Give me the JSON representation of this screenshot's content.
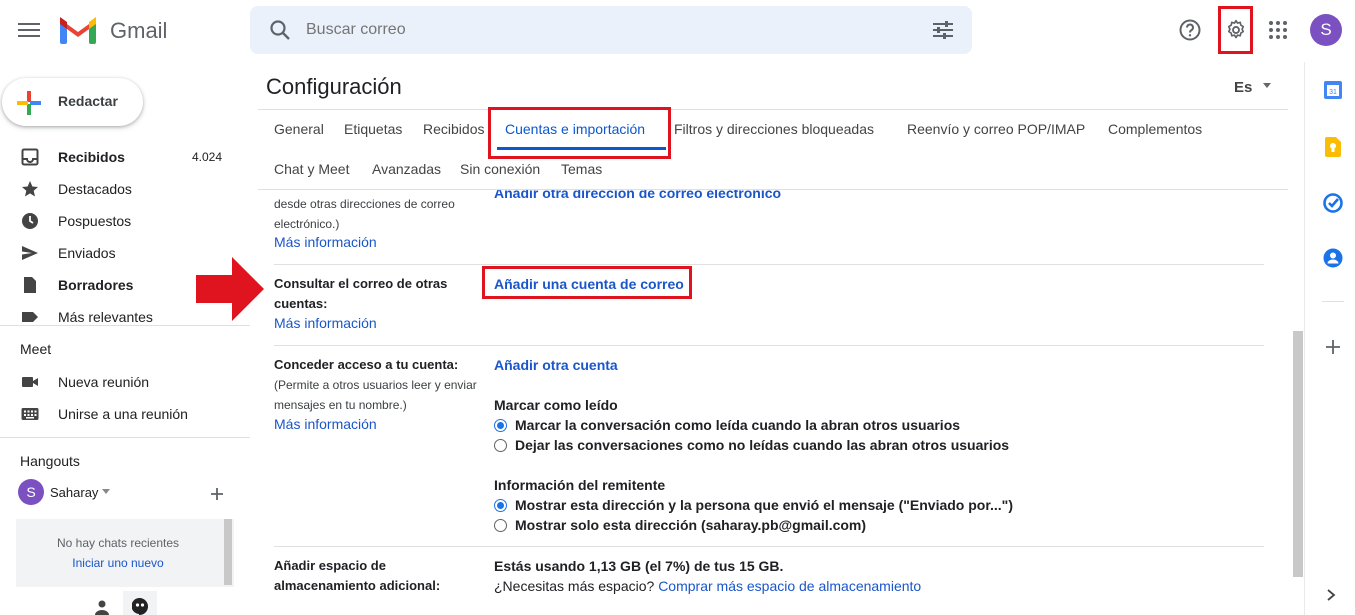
{
  "header": {
    "app_name": "Gmail",
    "search_placeholder": "Buscar correo",
    "avatar_letter": "S"
  },
  "sidebar": {
    "compose_label": "Redactar",
    "items": [
      {
        "label": "Recibidos",
        "count": "4.024"
      },
      {
        "label": "Destacados"
      },
      {
        "label": "Pospuestos"
      },
      {
        "label": "Enviados"
      },
      {
        "label": "Borradores"
      },
      {
        "label": "Más relevantes"
      }
    ],
    "meet": {
      "title": "Meet",
      "items": [
        {
          "label": "Nueva reunión"
        },
        {
          "label": "Unirse a una reunión"
        }
      ]
    },
    "hangouts": {
      "title": "Hangouts",
      "user_initial": "S",
      "user_name": "Saharay",
      "no_chats": "No hay chats recientes",
      "start_new": "Iniciar uno nuevo"
    }
  },
  "main": {
    "title": "Configuración",
    "lang": "Es",
    "tabs_row1": [
      "General",
      "Etiquetas",
      "Recibidos",
      "Cuentas e importación",
      "Filtros y direcciones bloqueadas",
      "Reenvío y correo POP/IMAP",
      "Complementos"
    ],
    "tabs_row2": [
      "Chat y Meet",
      "Avanzadas",
      "Sin conexión",
      "Temas"
    ],
    "send_as": {
      "desc_line1": "desde otras direcciones de correo",
      "desc_line2": "electrónico.)",
      "more_info": "Más información",
      "action": "Añadir otra dirección de correo electrónico"
    },
    "check_mail": {
      "label_line1": "Consultar el correo de otras",
      "label_line2": "cuentas:",
      "more_info": "Más información",
      "action": "Añadir una cuenta de correo"
    },
    "grant_access": {
      "label": "Conceder acceso a tu cuenta:",
      "desc_line1": "(Permite a otros usuarios leer y enviar",
      "desc_line2": "mensajes en tu nombre.)",
      "more_info": "Más información",
      "action": "Añadir otra cuenta",
      "mark_read_title": "Marcar como leído",
      "mark_read_opt1": "Marcar la conversación como leída cuando la abran otros usuarios",
      "mark_read_opt2": "Dejar las conversaciones como no leídas cuando las abran otros usuarios",
      "sender_info_title": "Información del remitente",
      "sender_opt1": "Mostrar esta dirección y la persona que envió el mensaje (\"Enviado por...\")",
      "sender_opt2": "Mostrar solo esta dirección (saharay.pb@gmail.com)"
    },
    "storage": {
      "label_line1": "Añadir espacio de",
      "label_line2": "almacenamiento adicional:",
      "usage": "Estás usando 1,13 GB (el 7%) de tus 15 GB.",
      "need_more": "¿Necesitas más espacio?",
      "buy_link": "Comprar más espacio de almacenamiento"
    }
  },
  "colors": {
    "accent": "#0b57d0",
    "highlight_red": "#e0141f",
    "avatar": "#7b50c0"
  }
}
